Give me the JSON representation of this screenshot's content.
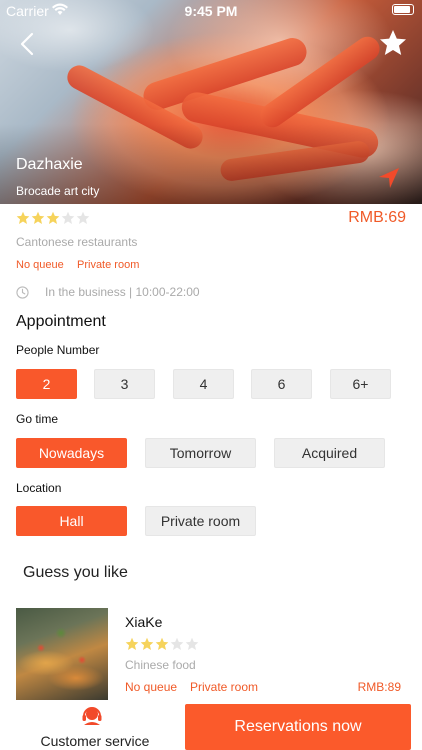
{
  "status_bar": {
    "carrier": "Carrier",
    "time": "9:45 PM"
  },
  "hero": {
    "title": "Dazhaxie",
    "subtitle": "Brocade art city"
  },
  "restaurant": {
    "rating": 3,
    "rating_max": 5,
    "price": "RMB:69",
    "cuisine": "Cantonese restaurants",
    "tags": [
      "No queue",
      "Private room"
    ],
    "hours": "In the business | 10:00-22:00"
  },
  "appointment": {
    "title": "Appointment",
    "people": {
      "label": "People Number",
      "options": [
        "2",
        "3",
        "4",
        "6",
        "6+"
      ],
      "selected": "2"
    },
    "go_time": {
      "label": "Go time",
      "options": [
        "Nowadays",
        "Tomorrow",
        "Acquired"
      ],
      "selected": "Nowadays"
    },
    "location": {
      "label": "Location",
      "options": [
        "Hall",
        "Private room"
      ],
      "selected": "Hall"
    }
  },
  "guess": {
    "title": "Guess you like",
    "items": [
      {
        "name": "XiaKe",
        "rating": 3,
        "cuisine": "Chinese food",
        "tags": [
          "No queue",
          "Private room"
        ],
        "price": "RMB:89"
      }
    ]
  },
  "bottom": {
    "service_label": "Customer service",
    "reserve_label": "Reservations now"
  },
  "colors": {
    "accent": "#f9582b",
    "star": "#f6d35b",
    "star_empty": "#e5e5e5"
  }
}
